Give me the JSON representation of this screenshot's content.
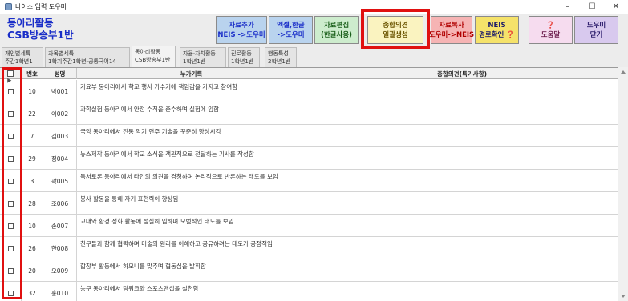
{
  "window": {
    "title": "나이스 입력 도우미",
    "controls": [
      "–",
      "☐",
      "✕"
    ]
  },
  "header": {
    "title_line1": "동아리활동",
    "title_line2": "CSB방송부1반"
  },
  "toolbar": {
    "buttons": [
      {
        "line1": "자료추가",
        "line2": "NEIS ->도우미",
        "bg": "#b9d3ee",
        "fg": "#1a2ec8"
      },
      {
        "line1": "엑셀,한글",
        "line2": "->도우미",
        "bg": "#b9d3ee",
        "fg": "#1a2ec8"
      },
      {
        "line1": "자료편집",
        "line2": "(한글사용)",
        "bg": "#cdeccd",
        "fg": "#1a5e1a"
      },
      {
        "line1": "종합의견",
        "line2": "일괄생성",
        "bg": "#faf3c0",
        "fg": "#6a5400"
      },
      {
        "line1": "자료복사",
        "line2": "도우미->NEIS",
        "bg": "#f6b4b4",
        "fg": "#b00000"
      },
      {
        "line1": "NEIS",
        "line2": "경로확인 ❓",
        "bg": "#f5e26a",
        "fg": "#1a1a6a"
      },
      {
        "line1": "❓",
        "line2": "도움말",
        "bg": "#f6dcef",
        "fg": "#6a1a4a"
      },
      {
        "line1": "도우미",
        "line2": "닫기",
        "bg": "#d8c9ee",
        "fg": "#2a1a6a"
      }
    ]
  },
  "tabs": [
    {
      "line1": "개인별세특",
      "line2": "주간1학년1"
    },
    {
      "line1": "과목별세특",
      "line2": "1학기주간1학년-공통국어14"
    },
    {
      "line1": "동아리활동",
      "line2": "CSB방송부1반"
    },
    {
      "line1": "자율·자치활동",
      "line2": "1학년1반"
    },
    {
      "line1": "진로활동",
      "line2": "1학년1반"
    },
    {
      "line1": "행동특성",
      "line2": "2학년1반"
    }
  ],
  "active_tab": 2,
  "grid": {
    "columns": {
      "check": "",
      "number": "번호",
      "name": "성명",
      "record": "누가기록",
      "opinion": "종합의견(특기사항)"
    },
    "rows": [
      {
        "num": "10",
        "name": "박001",
        "record": "가요부 동아리에서 학교 행사 가수기에 책임감을 가지고 참여함"
      },
      {
        "num": "22",
        "name": "이002",
        "record": "과학실험 동아리에서 안전 수칙을 준수하며 실험에 임함"
      },
      {
        "num": "7",
        "name": "김003",
        "record": "국악 동아리에서 전통 악기 연주 기술을 꾸준히 향상시킴"
      },
      {
        "num": "29",
        "name": "정004",
        "record": "뉴스제작 동아리에서 학교 소식을 객관적으로 전달하는 기사를 작성함"
      },
      {
        "num": "3",
        "name": "곽005",
        "record": "독서토론 동아리에서 타인의 의견을 경청하며 논리적으로 반론하는 태도를 보임"
      },
      {
        "num": "28",
        "name": "조006",
        "record": "봉사 활동을 통해 자기 표현력이 향상됨"
      },
      {
        "num": "10",
        "name": "손007",
        "record": "교내와 환경 정화 활동에 성실히 임하며 모범적인 태도를 보임"
      },
      {
        "num": "26",
        "name": "한008",
        "record": "친구들과 함께 협력하며 미술의 원리를 이해하고 공유하려는 태도가 긍정적임"
      },
      {
        "num": "20",
        "name": "오009",
        "record": "합창부 활동에서 하모니를 맞추며 협동심을 발휘함"
      },
      {
        "num": "32",
        "name": "홍010",
        "record": "농구 동아리에서 팀워크와 스포츠맨십을 실천함"
      }
    ]
  },
  "colors": {
    "highlight": "#e01010",
    "title_blue": "#1a2ec8"
  }
}
